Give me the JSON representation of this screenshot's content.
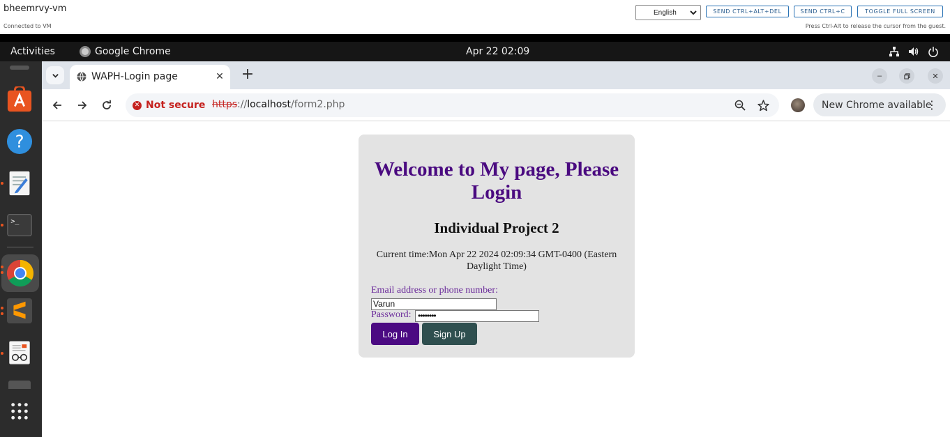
{
  "vm": {
    "name": "bheemrvy-vm",
    "status": "Connected to VM",
    "language": "English",
    "buttons": [
      "SEND CTRL+ALT+DEL",
      "SEND CTRL+C",
      "TOGGLE FULL SCREEN"
    ],
    "hint": "Press Ctrl-Alt to release the cursor from the guest."
  },
  "topbar": {
    "activities": "Activities",
    "app_name": "Google Chrome",
    "clock": "Apr 22  02:09"
  },
  "dock": {
    "items": [
      "ubuntu-software-icon",
      "help-icon",
      "text-editor-icon",
      "terminal-icon",
      "chrome-icon",
      "sublime-text-icon",
      "document-viewer-icon",
      "trash-icon"
    ],
    "show_apps_icon": "grid-icon"
  },
  "browser": {
    "tab_title": "WAPH-Login page",
    "security_label": "Not secure",
    "url_scheme": "https",
    "url_sep": "://",
    "url_host": "localhost",
    "url_path": "/form2.php",
    "update_label": "New Chrome available"
  },
  "page": {
    "heading": "Welcome to My page, Please Login",
    "subheading": "Individual Project 2",
    "current_time": "Current time:Mon Apr 22 2024 02:09:34 GMT-0400 (Eastern Daylight Time)",
    "email_label": "Email address or phone number:",
    "email_value": "Varun",
    "password_label": "Password:",
    "password_value": "••••••••",
    "login_label": "Log In",
    "signup_label": "Sign Up"
  },
  "colors": {
    "heading": "#4a0a80",
    "label": "#6a2a9a",
    "login_button": "#4b0a82",
    "signup_button": "#2f4f4f",
    "not_secure": "#c5221f"
  }
}
